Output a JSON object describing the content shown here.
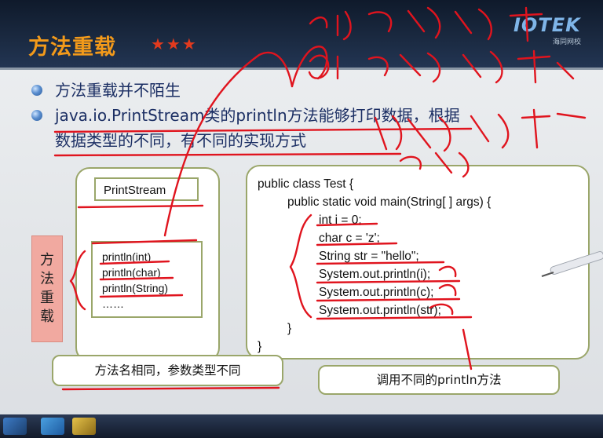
{
  "slide": {
    "title": "方法重载",
    "stars": "★★★",
    "logo": {
      "brand": "IOTEK",
      "sub": "海同网校"
    }
  },
  "bullets": [
    {
      "text": "方法重载并不陌生"
    },
    {
      "text": "java.io.PrintStream类的println方法能够打印数据，根据"
    },
    {
      "text": "数据类型的不同，有不同的实现方式"
    }
  ],
  "left_diagram": {
    "class_label": "PrintStream",
    "methods": [
      "println(int)",
      "println(char)",
      "println(String)",
      "……"
    ],
    "side_label": [
      "方",
      "法",
      "重",
      "载"
    ],
    "callout": "方法名相同，参数类型不同"
  },
  "code": {
    "lines": [
      "public class Test {",
      "public static void main(String[ ] args) {",
      "int i = 0;",
      "char c = 'z';",
      "String str = \"hello\";",
      "System.out.println(i);",
      "System.out.println(c);",
      "System.out.println(str);",
      "}",
      "}"
    ],
    "callout": "调用不同的println方法"
  },
  "colors": {
    "title": "#f39a1a",
    "bullet_text": "#1c2f64",
    "annotation_ink": "#e0141e",
    "box_border": "#9aa66a",
    "side_badge": "#f1a9a0"
  },
  "annotation_icons": [
    "red-pen-handwriting",
    "stylus-pen-icon"
  ]
}
